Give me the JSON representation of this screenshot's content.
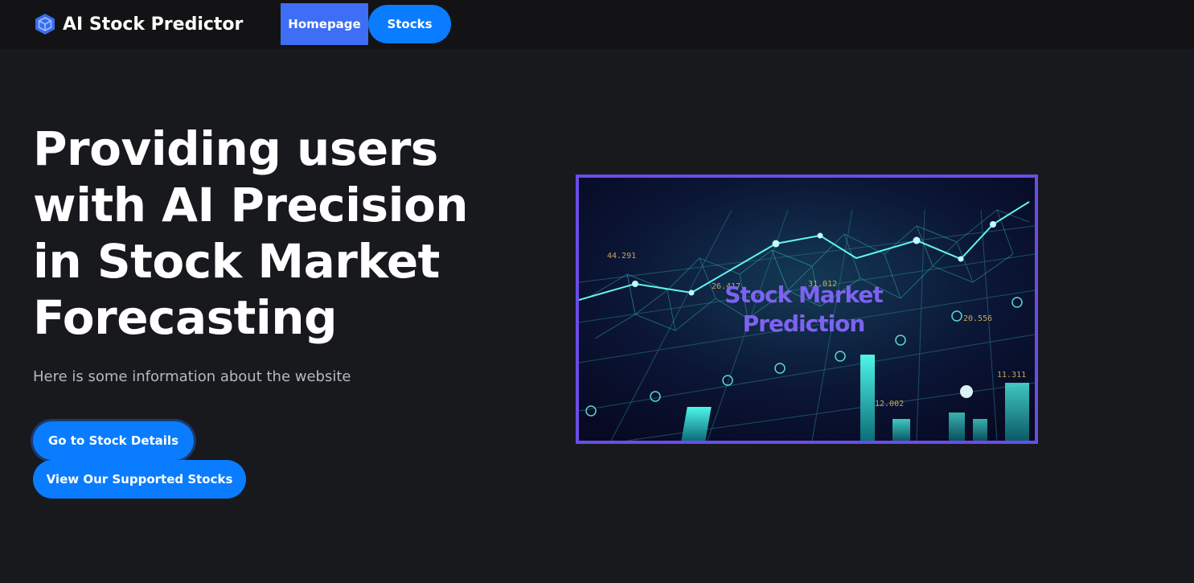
{
  "navbar": {
    "brand": "AI Stock Predictor",
    "brand_icon": "cube-icon",
    "links": {
      "home": "Homepage",
      "stocks": "Stocks"
    }
  },
  "hero": {
    "title": "Providing users with AI Precision in Stock Market Forecasting",
    "subtitle": "Here is some information about the website",
    "buttons": {
      "details": "Go to Stock Details",
      "supported": "View Our Supported Stocks"
    },
    "image": {
      "caption_line1": "Stock Market",
      "caption_line2": "Prediction",
      "overlay_numbers": [
        "44.291",
        "26.417",
        "31.012",
        "20.556",
        "12.002",
        "11.311"
      ]
    }
  },
  "colors": {
    "background": "#18191d",
    "navbar": "#131315",
    "nav_active": "#3d6ef5",
    "accent": "#0a7cff",
    "image_border": "#6a4de6",
    "caption": "#7e62f0"
  }
}
